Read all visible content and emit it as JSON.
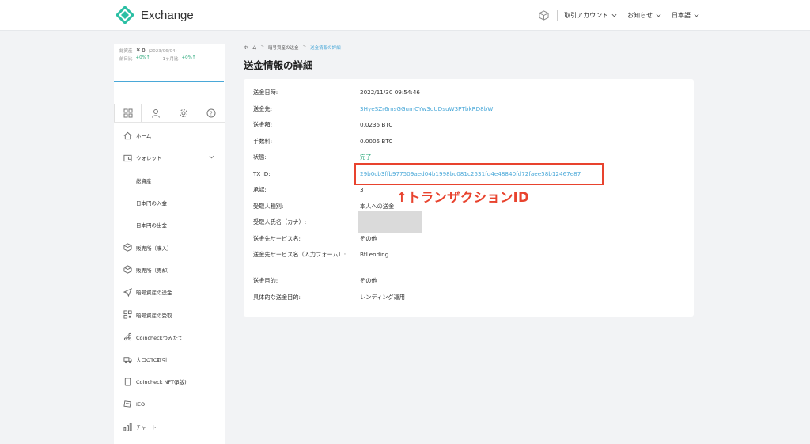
{
  "header": {
    "app_name": "Exchange",
    "menu": [
      {
        "label": "取引アカウント"
      },
      {
        "label": "お知らせ"
      },
      {
        "label": "日本語"
      }
    ],
    "brand_color": "#2bbfa4"
  },
  "sidebar": {
    "asset": {
      "total_label": "総資産",
      "total_value": "¥ 0",
      "date": "(2023/06/04)",
      "day_label": "前日比",
      "day_value": "+0%↑",
      "month_label": "1ヶ月比",
      "month_value": "+0%↑"
    },
    "tab_icons": [
      "grid-icon",
      "user-icon",
      "gear-icon",
      "help-icon"
    ],
    "items": [
      {
        "label": "ホーム",
        "icon": "home-icon"
      },
      {
        "label": "ウォレット",
        "icon": "wallet-icon"
      },
      {
        "label": "総資産"
      },
      {
        "label": "日本円の入金"
      },
      {
        "label": "日本円の出金"
      },
      {
        "label": "販売所（購入）",
        "icon": "box-icon"
      },
      {
        "label": "販売所（売却）",
        "icon": "box-icon"
      },
      {
        "label": "暗号資産の送金",
        "icon": "send-icon"
      },
      {
        "label": "暗号資産の受取",
        "icon": "qr-icon"
      },
      {
        "label": "Coincheckつみたて",
        "icon": "stack-icon"
      },
      {
        "label": "大口OTC取引",
        "icon": "truck-icon"
      },
      {
        "label": "Coincheck NFT(β版)",
        "icon": "nft-icon"
      },
      {
        "label": "IEO",
        "icon": "ieo-icon"
      },
      {
        "label": "チャート",
        "icon": "chart-icon"
      }
    ]
  },
  "breadcrumb": [
    "ホーム",
    "暗号資産の送金",
    "送金情報の詳細"
  ],
  "page_title": "送金情報の詳細",
  "details": [
    {
      "label": "送金日時:",
      "value": "2022/11/30 09:54:46"
    },
    {
      "label": "送金先:",
      "value": "3HyeSZr6msGGumCYw3dUDsuW3PTbkRD8bW"
    },
    {
      "label": "送金額:",
      "value": "0.0235 BTC"
    },
    {
      "label": "手数料:",
      "value": "0.0005 BTC"
    },
    {
      "label": "状態:",
      "value": "完了"
    },
    {
      "label": "TX ID:",
      "value": "29b0cb3ffb977509aed04b1998bc081c2531fd4e48840fd72faee58b12467e87"
    },
    {
      "label": "承認:",
      "value": "3"
    },
    {
      "label": "受取人種別:",
      "value": "本人への送金"
    },
    {
      "label": "受取人氏名（カナ）:",
      "value": ""
    },
    {
      "label": "送金先サービス名:",
      "value": "その他"
    },
    {
      "label": "送金先サービス名（入力フォーム）:",
      "value": "BtLending"
    },
    {
      "label": "送金目的:",
      "value": "その他"
    },
    {
      "label": "具体的な送金目的:",
      "value": "レンディング運用"
    }
  ],
  "annotation": "↑トランザクションID",
  "colors": {
    "link": "#4aa8d8",
    "success": "#2aa87a",
    "highlight": "#e8432e"
  }
}
